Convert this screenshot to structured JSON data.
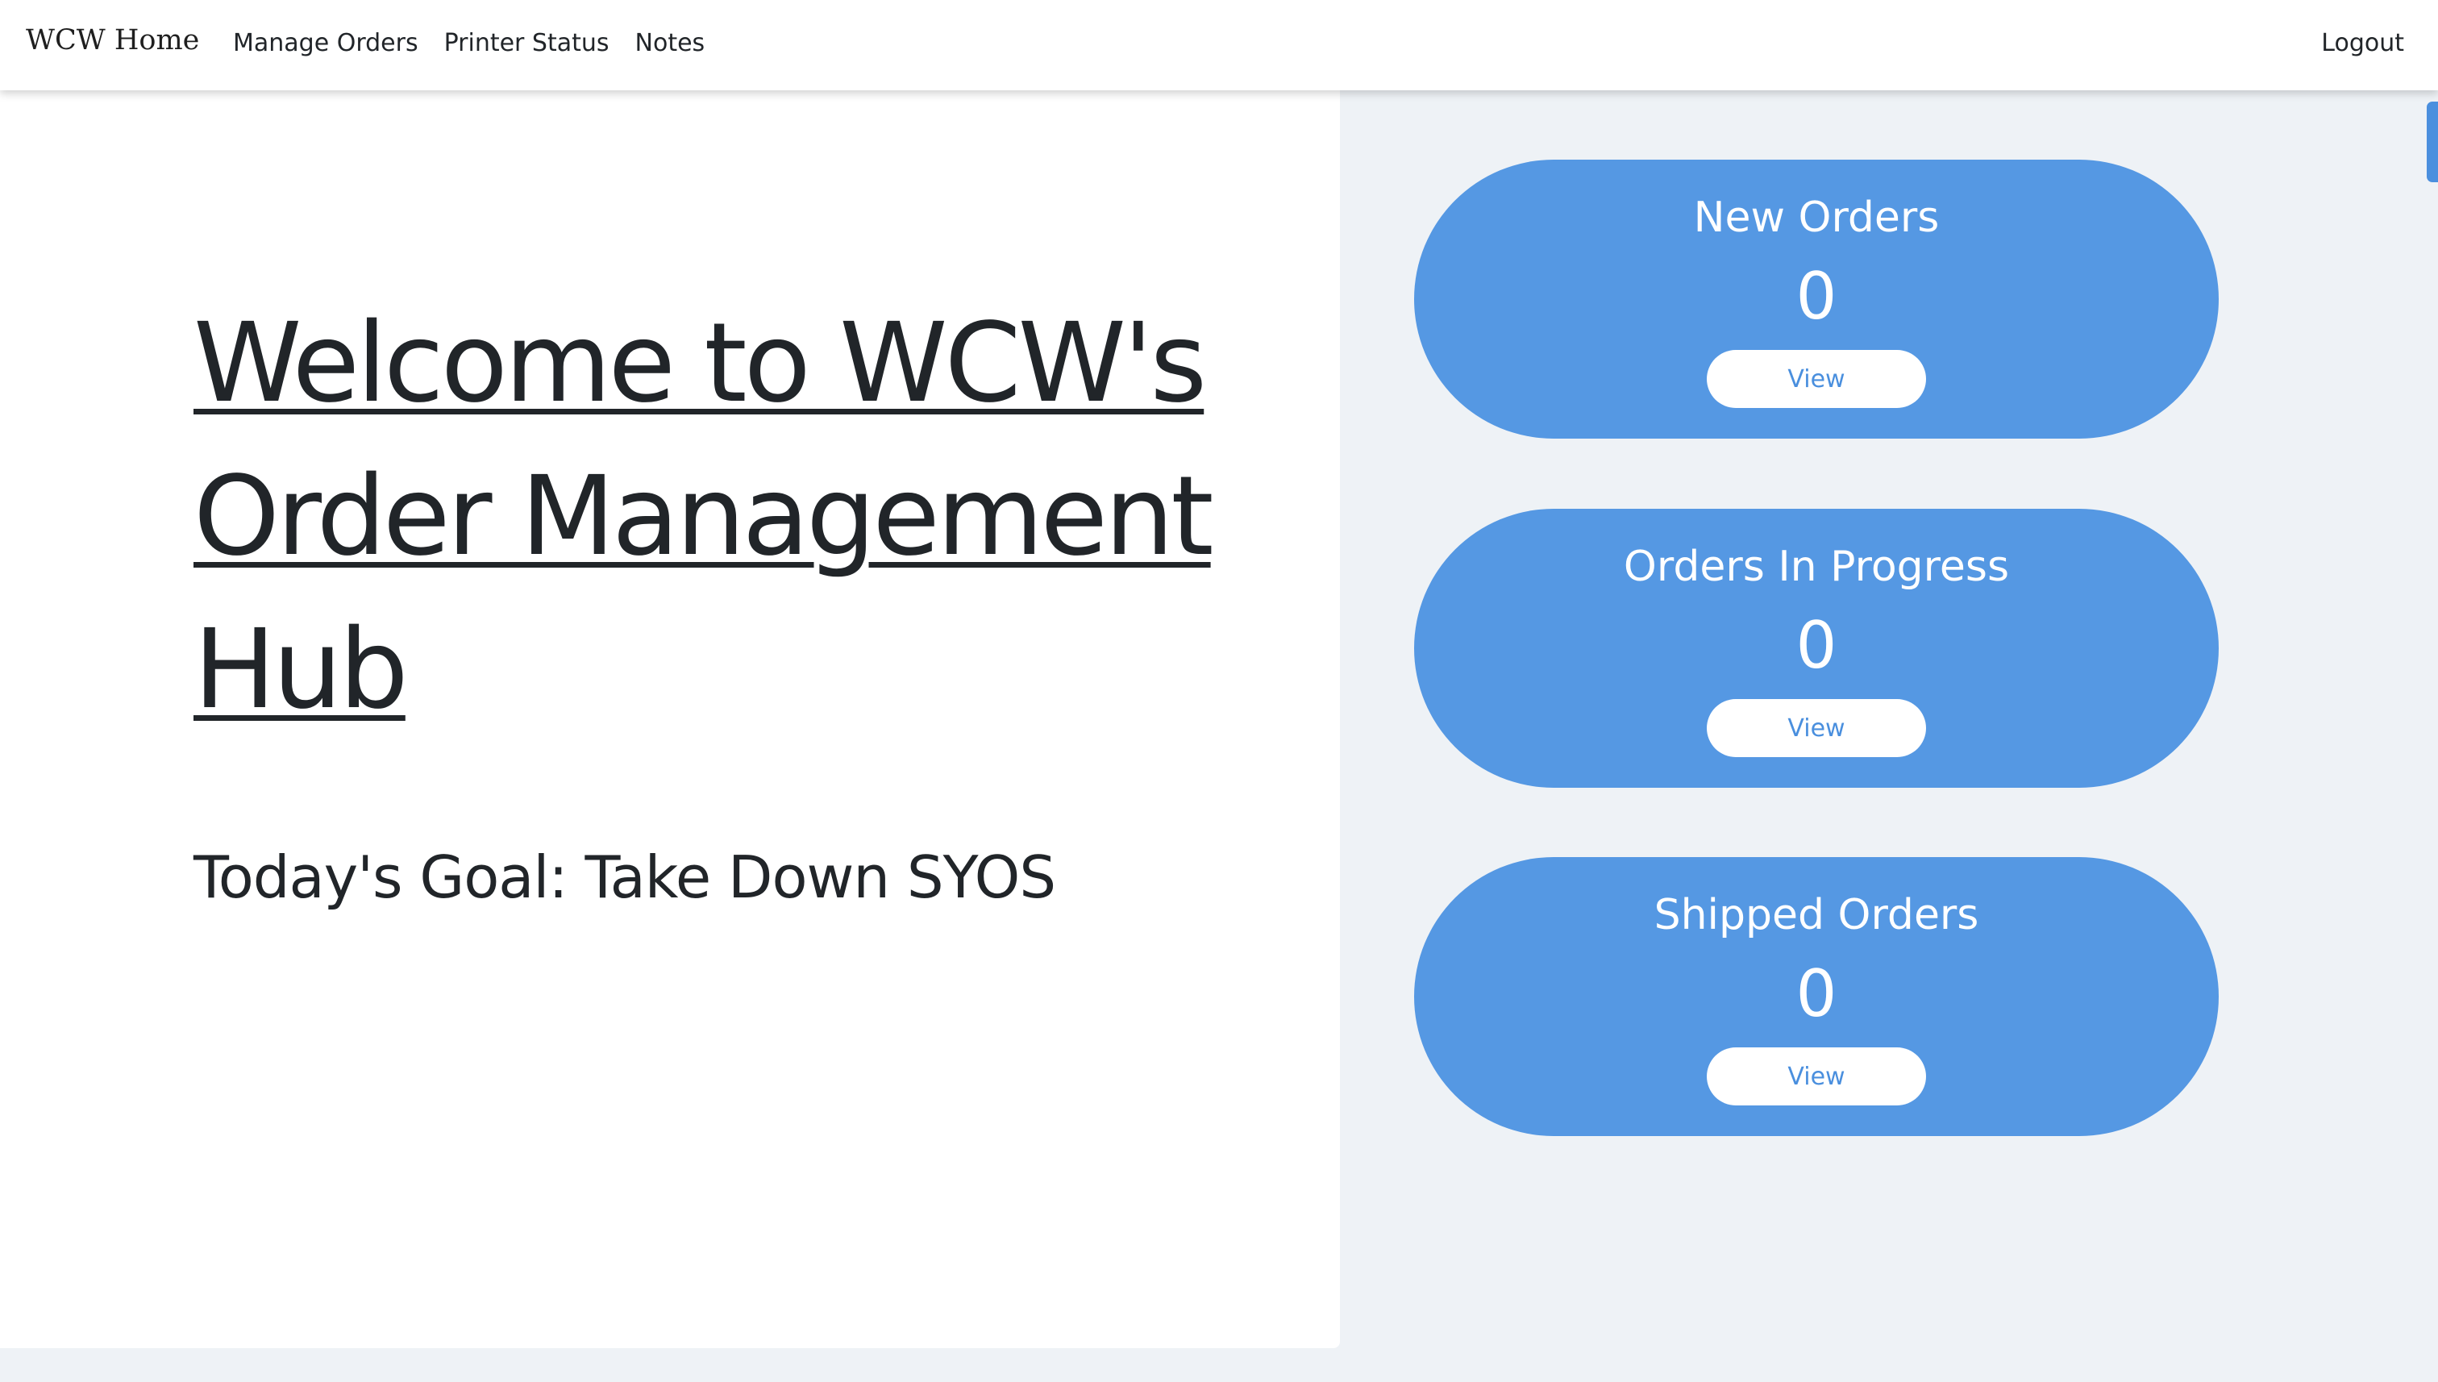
{
  "navbar": {
    "brand": "WCW Home",
    "links": [
      {
        "label": "Manage Orders"
      },
      {
        "label": "Printer Status"
      },
      {
        "label": "Notes"
      }
    ],
    "logout": "Logout"
  },
  "hero": {
    "title": "Welcome to WCW's Order Management Hub",
    "goal": "Today's Goal: Take Down SYOS"
  },
  "cards": [
    {
      "title": "New Orders",
      "count": "0",
      "button": "View"
    },
    {
      "title": "Orders In Progress",
      "count": "0",
      "button": "View"
    },
    {
      "title": "Shipped Orders",
      "count": "0",
      "button": "View"
    }
  ],
  "colors": {
    "card_bg": "#5598e3",
    "page_bg": "#eef2f6",
    "button_text": "#4a8fde"
  }
}
